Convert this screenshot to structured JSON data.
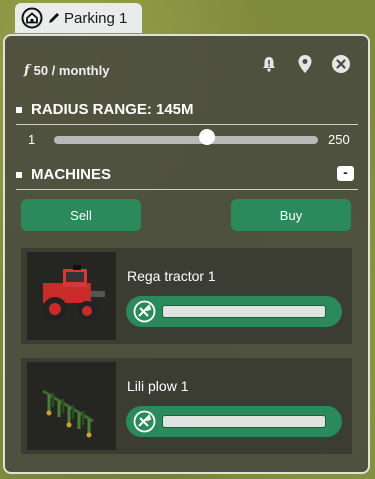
{
  "tab": {
    "title": "Parking 1",
    "home_icon": "home-icon",
    "edit_icon": "pencil-icon"
  },
  "panel": {
    "fee": {
      "icon": "f",
      "text": "50 / monthly"
    },
    "icons": [
      "bell-icon",
      "location-pin-icon",
      "close-icon"
    ],
    "radius": {
      "title": "RADIUS RANGE: 145M",
      "min": "1",
      "max": "250",
      "value": 145
    },
    "machines": {
      "title": "MACHINES",
      "collapse_label": "-",
      "sell_label": "Sell",
      "buy_label": "Buy",
      "items": [
        {
          "name": "Rega tractor 1",
          "image": "red-tractor",
          "condition": 1.0
        },
        {
          "name": "Lili plow 1",
          "image": "green-plow",
          "condition": 1.0
        }
      ]
    }
  }
}
